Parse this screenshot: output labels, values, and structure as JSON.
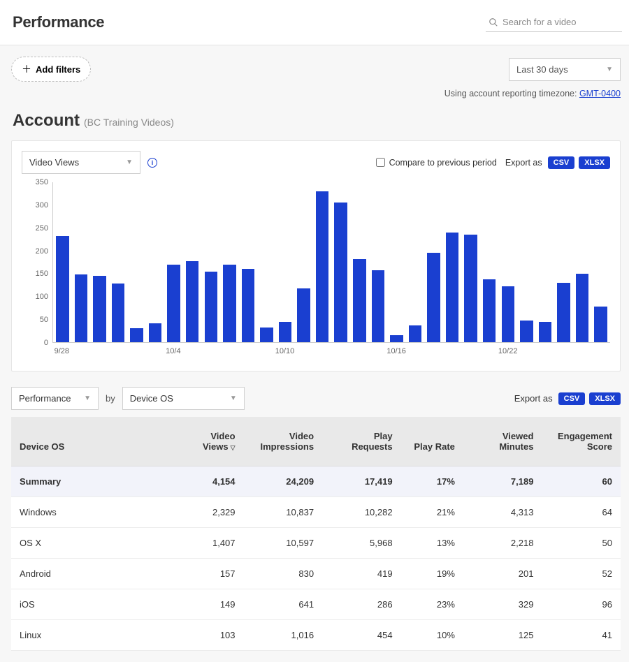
{
  "header": {
    "title": "Performance",
    "search_placeholder": "Search for a video"
  },
  "filters": {
    "add_filters_label": "Add filters",
    "date_range": "Last 30 days",
    "timezone_prefix": "Using account reporting timezone: ",
    "timezone_value": "GMT-0400"
  },
  "account": {
    "title": "Account",
    "subtitle": "(BC Training Videos)"
  },
  "chart_toolbar": {
    "metric": "Video Views",
    "compare_label": "Compare to previous period",
    "export_label": "Export as",
    "export_csv": "CSV",
    "export_xlsx": "XLSX"
  },
  "chart_data": {
    "type": "bar",
    "ylabel": "",
    "xlabel": "",
    "ylim": [
      0,
      350
    ],
    "y_ticks": [
      0,
      50,
      100,
      150,
      200,
      250,
      300,
      350
    ],
    "x_tick_labels": [
      "9/28",
      "10/4",
      "10/10",
      "10/16",
      "10/22"
    ],
    "x_tick_positions": [
      0,
      6,
      12,
      18,
      24
    ],
    "categories": [
      "9/27",
      "9/28",
      "9/29",
      "9/30",
      "10/1",
      "10/2",
      "10/3",
      "10/4",
      "10/5",
      "10/6",
      "10/7",
      "10/8",
      "10/9",
      "10/10",
      "10/11",
      "10/12",
      "10/13",
      "10/14",
      "10/15",
      "10/16",
      "10/17",
      "10/18",
      "10/19",
      "10/20",
      "10/21",
      "10/22",
      "10/23",
      "10/24",
      "10/25",
      "10/26"
    ],
    "values": [
      232,
      148,
      145,
      128,
      30,
      42,
      170,
      178,
      155,
      170,
      160,
      32,
      45,
      118,
      330,
      305,
      182,
      158,
      15,
      37,
      195,
      240,
      235,
      138,
      122,
      48,
      45,
      130,
      150,
      78
    ]
  },
  "breakdown": {
    "perf_select": "Performance",
    "by_text": "by",
    "dimension_select": "Device OS",
    "export_label": "Export as",
    "export_csv": "CSV",
    "export_xlsx": "XLSX"
  },
  "table": {
    "headers": {
      "dimension": "Device OS",
      "video_views": "Video Views",
      "video_impressions": "Video Impressions",
      "play_requests": "Play Requests",
      "play_rate": "Play Rate",
      "viewed_minutes": "Viewed Minutes",
      "engagement_score": "Engagement Score"
    },
    "summary": {
      "label": "Summary",
      "video_views": "4,154",
      "video_impressions": "24,209",
      "play_requests": "17,419",
      "play_rate": "17%",
      "viewed_minutes": "7,189",
      "engagement_score": "60"
    },
    "rows": [
      {
        "label": "Windows",
        "video_views": "2,329",
        "video_impressions": "10,837",
        "play_requests": "10,282",
        "play_rate": "21%",
        "viewed_minutes": "4,313",
        "engagement_score": "64"
      },
      {
        "label": "OS X",
        "video_views": "1,407",
        "video_impressions": "10,597",
        "play_requests": "5,968",
        "play_rate": "13%",
        "viewed_minutes": "2,218",
        "engagement_score": "50"
      },
      {
        "label": "Android",
        "video_views": "157",
        "video_impressions": "830",
        "play_requests": "419",
        "play_rate": "19%",
        "viewed_minutes": "201",
        "engagement_score": "52"
      },
      {
        "label": "iOS",
        "video_views": "149",
        "video_impressions": "641",
        "play_requests": "286",
        "play_rate": "23%",
        "viewed_minutes": "329",
        "engagement_score": "96"
      },
      {
        "label": "Linux",
        "video_views": "103",
        "video_impressions": "1,016",
        "play_requests": "454",
        "play_rate": "10%",
        "viewed_minutes": "125",
        "engagement_score": "41"
      }
    ]
  }
}
